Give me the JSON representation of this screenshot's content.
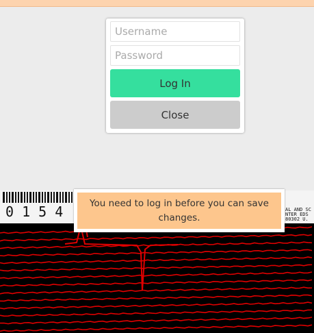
{
  "login": {
    "username_placeholder": "Username",
    "password_placeholder": "Password",
    "login_label": "Log In",
    "close_label": "Close"
  },
  "toast": {
    "message": "You need to log in before you can save changes."
  },
  "background_image": {
    "number_stamp": "0 1 5 4",
    "label_text_lines": [
      "AL AND SC",
      "NTER EDS",
      "80302 U."
    ]
  },
  "colors": {
    "banner": "#fdd3ae",
    "login_button": "#35df9e",
    "close_button": "#cccccc",
    "toast": "#fdc68d",
    "trace": "#e00000"
  }
}
